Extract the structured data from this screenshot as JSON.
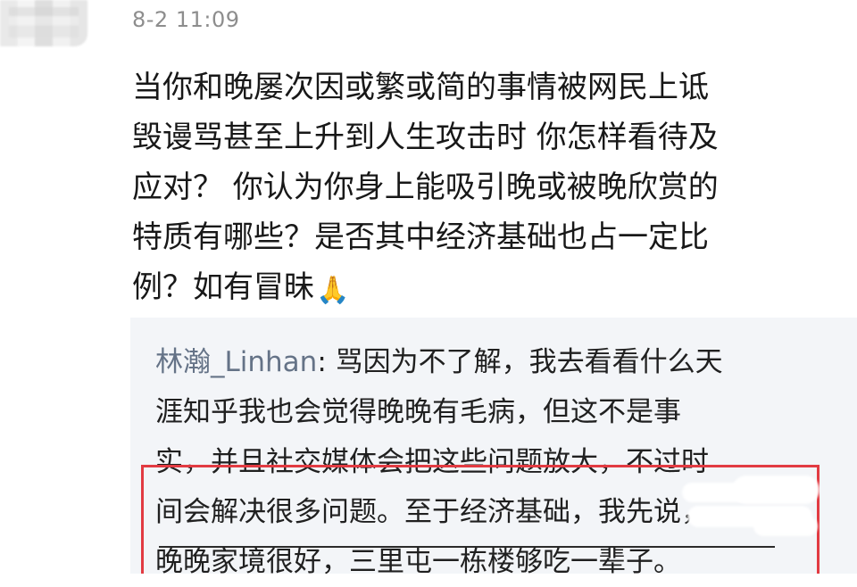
{
  "timestamp": "8-2 11:09",
  "question": {
    "lines": [
      "当你和晚屡次因或繁或简的事情被网民上诋",
      "毁谩骂甚至上升到人生攻击时 你怎样看待及",
      "应对？ 你认为你身上能吸引晚或被晚欣赏的",
      "特质有哪些？是否其中经济基础也占一定比",
      "例？如有冒昧"
    ],
    "icon": "folded-hands-icon",
    "icon_glyph": "🙏"
  },
  "reply": {
    "username": "林瀚_Linhan",
    "colon": ": ",
    "lines": [
      "骂因为不了解，我去看看什么天",
      "涯知乎我也会觉得晚晚有毛病，但这不是事",
      "实，并且社交媒体会把这些问题放大，不过时",
      "间会解决很多问题。至于经济基础，我先说，",
      "晚晚家境很好，三里屯一栋楼够吃一辈子。"
    ]
  },
  "colors": {
    "timestamp": "#8d8d8d",
    "username": "#657387",
    "highlight_border": "#e23b42",
    "reply_background": "#f3f5f8"
  }
}
